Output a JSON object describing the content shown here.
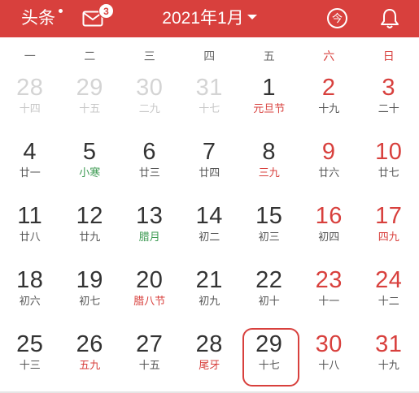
{
  "header": {
    "left_label": "头条",
    "mail_badge": "3",
    "title": "2021年1月",
    "today_glyph": "今",
    "icons": {
      "mail": "mail-icon",
      "today": "today-icon",
      "bell": "bell-icon",
      "dropdown": "chevron-down-icon"
    }
  },
  "colors": {
    "accent": "#d8403d",
    "festival_green": "#3c9a52"
  },
  "weekdays": [
    "一",
    "二",
    "三",
    "四",
    "五",
    "六",
    "日"
  ],
  "days": [
    {
      "d": "28",
      "l": "十四",
      "other": true
    },
    {
      "d": "29",
      "l": "十五",
      "other": true
    },
    {
      "d": "30",
      "l": "二九",
      "other": true
    },
    {
      "d": "31",
      "l": "十七",
      "other": true
    },
    {
      "d": "1",
      "l": "元旦节",
      "lc": "red"
    },
    {
      "d": "2",
      "l": "十九"
    },
    {
      "d": "3",
      "l": "二十"
    },
    {
      "d": "4",
      "l": "廿一"
    },
    {
      "d": "5",
      "l": "小寒",
      "lc": "green"
    },
    {
      "d": "6",
      "l": "廿三"
    },
    {
      "d": "7",
      "l": "廿四"
    },
    {
      "d": "8",
      "l": "三九",
      "lc": "red"
    },
    {
      "d": "9",
      "l": "廿六"
    },
    {
      "d": "10",
      "l": "廿七"
    },
    {
      "d": "11",
      "l": "廿八"
    },
    {
      "d": "12",
      "l": "廿九"
    },
    {
      "d": "13",
      "l": "腊月",
      "lc": "green"
    },
    {
      "d": "14",
      "l": "初二"
    },
    {
      "d": "15",
      "l": "初三"
    },
    {
      "d": "16",
      "l": "初四"
    },
    {
      "d": "17",
      "l": "四九",
      "lc": "red"
    },
    {
      "d": "18",
      "l": "初六"
    },
    {
      "d": "19",
      "l": "初七"
    },
    {
      "d": "20",
      "l": "腊八节",
      "lc": "red"
    },
    {
      "d": "21",
      "l": "初九"
    },
    {
      "d": "22",
      "l": "初十"
    },
    {
      "d": "23",
      "l": "十一"
    },
    {
      "d": "24",
      "l": "十二"
    },
    {
      "d": "25",
      "l": "十三"
    },
    {
      "d": "26",
      "l": "五九",
      "lc": "red"
    },
    {
      "d": "27",
      "l": "十五"
    },
    {
      "d": "28",
      "l": "尾牙",
      "lc": "red"
    },
    {
      "d": "29",
      "l": "十七",
      "today": true
    },
    {
      "d": "30",
      "l": "十八"
    },
    {
      "d": "31",
      "l": "十九"
    }
  ]
}
